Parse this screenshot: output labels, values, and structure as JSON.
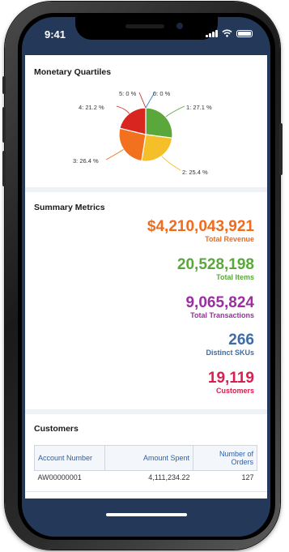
{
  "status_bar": {
    "time": "9:41"
  },
  "quartiles": {
    "title": "Monetary Quartiles",
    "slices": [
      {
        "label": "1: 27.1 %",
        "value": 27.1,
        "color": "#5aa83c"
      },
      {
        "label": "2: 25.4 %",
        "value": 25.4,
        "color": "#f5bf2a"
      },
      {
        "label": "3: 26.4 %",
        "value": 26.4,
        "color": "#f2711f"
      },
      {
        "label": "4: 21.2 %",
        "value": 21.2,
        "color": "#d9251f"
      },
      {
        "label": "5: 0 %",
        "value": 0,
        "color": "#c0392b"
      },
      {
        "label": "0: 0 %",
        "value": 0,
        "color": "#3f78c9"
      }
    ]
  },
  "summary": {
    "title": "Summary Metrics",
    "metrics": [
      {
        "value": "$4,210,043,921",
        "label": "Total Revenue",
        "color": "#f26a1b"
      },
      {
        "value": "20,528,198",
        "label": "Total Items",
        "color": "#5aa83c"
      },
      {
        "value": "9,065,824",
        "label": "Total Transactions",
        "color": "#9b2ea0"
      },
      {
        "value": "266",
        "label": "Distinct SKUs",
        "color": "#3d6ca8"
      },
      {
        "value": "19,119",
        "label": "Customers",
        "color": "#d6204f"
      }
    ]
  },
  "customers": {
    "title": "Customers",
    "columns": [
      "Account Number",
      "Amount Spent",
      "Number of Orders"
    ],
    "rows": [
      [
        "AW00000001",
        "4,111,234.22",
        "127"
      ]
    ]
  },
  "tabbar": {
    "icons": [
      "bookmark-icon",
      "filter-icon",
      "search-icon",
      "more-icon"
    ]
  }
}
